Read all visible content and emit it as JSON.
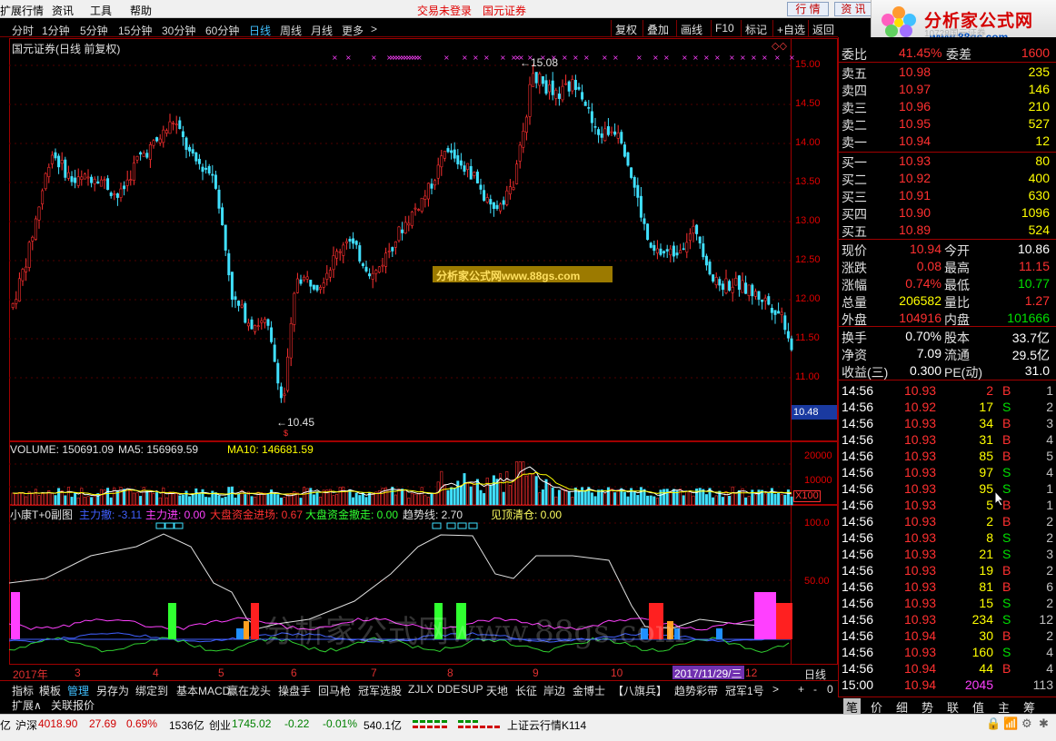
{
  "menu": {
    "items": [
      "扩展行情",
      "资讯",
      "工具",
      "帮助"
    ],
    "trade_status": "交易未登录",
    "broker_name": "国元证券",
    "buttons": [
      "行 情",
      "资 讯"
    ]
  },
  "logo": {
    "title": "分析家公式网",
    "subtitle": "www.88gs.com",
    "faint_caption": "10728国元证券"
  },
  "periods": {
    "items": [
      "分时",
      "1分钟",
      "5分钟",
      "15分钟",
      "30分钟",
      "60分钟",
      "日线",
      "周线",
      "月线",
      "更多"
    ],
    "active": "日线",
    "more_arrow": ">",
    "right_buttons": [
      "复权",
      "叠加",
      "画线",
      "F10",
      "标记",
      "+自选",
      "返回"
    ]
  },
  "chart": {
    "stock_title": "国元证券(日线 前复权)",
    "price_axis": [
      "15.00",
      "14.50",
      "14.00",
      "13.50",
      "13.00",
      "12.50",
      "12.00",
      "11.50",
      "11.00"
    ],
    "current_price_tag": "10.48",
    "high_label": "15.08",
    "low_label": "10.45",
    "high_arrow": "←",
    "low_arrow": "←",
    "watermark": "分析家公式网www.88gs.com",
    "bottom_watermark": "分析家公式网www.88gs.com",
    "volume_legend": {
      "volume_label": "VOLUME: 150691.09",
      "ma5_label": "MA5: 156969.59",
      "ma10_label": "MA10: 146681.59"
    },
    "volume_axis": [
      "20000",
      "10000"
    ],
    "volume_unit": "X100",
    "indicator_legend": {
      "name": "小康T+0副图",
      "main_sell": "主力撤: -3.11",
      "main_buy": "主力进: 0.00",
      "big_in": "大盘资金进场: 0.67",
      "big_out": "大盘资金撤走: 0.00",
      "trend": "趋势线: 2.70",
      "top_clear": "见顶清仓: 0.00"
    },
    "indicator_axis": [
      "100.0",
      "50.00"
    ],
    "time_axis": [
      "2017年",
      "3",
      "4",
      "5",
      "6",
      "7",
      "8",
      "9",
      "10",
      "12"
    ],
    "cursor_date": "2017/11/29/三",
    "period_label": "日线",
    "colors": {
      "up": "#ff3030",
      "down": "#40e0ff",
      "frame": "#a00000",
      "ma5": "#ffffff",
      "ma10": "#ffff00"
    }
  },
  "tabs": {
    "row1": [
      "指标",
      "模板",
      "管理",
      "另存为",
      "绑定到",
      "基本MACD",
      "赢在龙头",
      "操盘手",
      "回马枪",
      "冠军选股",
      "ZJLX",
      "DDE",
      "SUP",
      "天地",
      "长征",
      "岸边",
      "金博士",
      "【八旗兵】",
      "趋势彩带",
      "冠军1号",
      ">"
    ],
    "active": "管理",
    "row1_controls": [
      "+",
      "-",
      "0"
    ],
    "row2": [
      "扩展∧",
      "关联报价"
    ]
  },
  "quote": {
    "weibi": {
      "label": "委比",
      "value": "41.45%",
      "label2": "委差",
      "value2": "1600"
    },
    "asks": [
      {
        "label": "卖五",
        "price": "10.98",
        "vol": "235"
      },
      {
        "label": "卖四",
        "price": "10.97",
        "vol": "146"
      },
      {
        "label": "卖三",
        "price": "10.96",
        "vol": "210"
      },
      {
        "label": "卖二",
        "price": "10.95",
        "vol": "527"
      },
      {
        "label": "卖一",
        "price": "10.94",
        "vol": "12"
      }
    ],
    "bids": [
      {
        "label": "买一",
        "price": "10.93",
        "vol": "80"
      },
      {
        "label": "买二",
        "price": "10.92",
        "vol": "400"
      },
      {
        "label": "买三",
        "price": "10.91",
        "vol": "630"
      },
      {
        "label": "买四",
        "price": "10.90",
        "vol": "1096"
      },
      {
        "label": "买五",
        "price": "10.89",
        "vol": "524"
      }
    ],
    "stats": [
      {
        "l1": "现价",
        "v1": "10.94",
        "c1": "red",
        "l2": "今开",
        "v2": "10.86",
        "c2": "wht"
      },
      {
        "l1": "涨跌",
        "v1": "0.08",
        "c1": "red",
        "l2": "最高",
        "v2": "11.15",
        "c2": "red"
      },
      {
        "l1": "涨幅",
        "v1": "0.74%",
        "c1": "red",
        "l2": "最低",
        "v2": "10.77",
        "c2": "grn"
      },
      {
        "l1": "总量",
        "v1": "206582",
        "c1": "yel",
        "l2": "量比",
        "v2": "1.27",
        "c2": "red"
      },
      {
        "l1": "外盘",
        "v1": "104916",
        "c1": "red",
        "l2": "内盘",
        "v2": "101666",
        "c2": "grn"
      }
    ],
    "fund": [
      {
        "l1": "换手",
        "v1": "0.70%",
        "l2": "股本",
        "v2": "33.7亿"
      },
      {
        "l1": "净资",
        "v1": "7.09",
        "l2": "流通",
        "v2": "29.5亿"
      },
      {
        "l1": "收益(三)",
        "v1": "0.300",
        "l2": "PE(动)",
        "v2": "31.0"
      }
    ],
    "ticks": [
      {
        "t": "14:56",
        "p": "10.93",
        "pc": "red",
        "v": "2",
        "vc": "red",
        "bs": "B",
        "bc": "red",
        "n": "1"
      },
      {
        "t": "14:56",
        "p": "10.92",
        "pc": "red",
        "v": "17",
        "vc": "yel",
        "bs": "S",
        "bc": "grn",
        "n": "2"
      },
      {
        "t": "14:56",
        "p": "10.93",
        "pc": "red",
        "v": "34",
        "vc": "yel",
        "bs": "B",
        "bc": "red",
        "n": "3"
      },
      {
        "t": "14:56",
        "p": "10.93",
        "pc": "red",
        "v": "31",
        "vc": "yel",
        "bs": "B",
        "bc": "red",
        "n": "4"
      },
      {
        "t": "14:56",
        "p": "10.93",
        "pc": "red",
        "v": "85",
        "vc": "yel",
        "bs": "B",
        "bc": "red",
        "n": "5"
      },
      {
        "t": "14:56",
        "p": "10.93",
        "pc": "red",
        "v": "97",
        "vc": "yel",
        "bs": "S",
        "bc": "grn",
        "n": "4"
      },
      {
        "t": "14:56",
        "p": "10.93",
        "pc": "red",
        "v": "95",
        "vc": "yel",
        "bs": "S",
        "bc": "grn",
        "n": "1"
      },
      {
        "t": "14:56",
        "p": "10.93",
        "pc": "red",
        "v": "5",
        "vc": "yel",
        "bs": "B",
        "bc": "red",
        "n": "1"
      },
      {
        "t": "14:56",
        "p": "10.93",
        "pc": "red",
        "v": "2",
        "vc": "yel",
        "bs": "B",
        "bc": "red",
        "n": "2"
      },
      {
        "t": "14:56",
        "p": "10.93",
        "pc": "red",
        "v": "8",
        "vc": "yel",
        "bs": "S",
        "bc": "grn",
        "n": "2"
      },
      {
        "t": "14:56",
        "p": "10.93",
        "pc": "red",
        "v": "21",
        "vc": "yel",
        "bs": "S",
        "bc": "grn",
        "n": "3"
      },
      {
        "t": "14:56",
        "p": "10.93",
        "pc": "red",
        "v": "19",
        "vc": "yel",
        "bs": "B",
        "bc": "red",
        "n": "2"
      },
      {
        "t": "14:56",
        "p": "10.93",
        "pc": "red",
        "v": "81",
        "vc": "yel",
        "bs": "B",
        "bc": "red",
        "n": "6"
      },
      {
        "t": "14:56",
        "p": "10.93",
        "pc": "red",
        "v": "15",
        "vc": "yel",
        "bs": "S",
        "bc": "grn",
        "n": "2"
      },
      {
        "t": "14:56",
        "p": "10.93",
        "pc": "red",
        "v": "234",
        "vc": "yel",
        "bs": "S",
        "bc": "grn",
        "n": "12"
      },
      {
        "t": "14:56",
        "p": "10.94",
        "pc": "red",
        "v": "30",
        "vc": "yel",
        "bs": "B",
        "bc": "red",
        "n": "2"
      },
      {
        "t": "14:56",
        "p": "10.93",
        "pc": "red",
        "v": "160",
        "vc": "yel",
        "bs": "S",
        "bc": "grn",
        "n": "4"
      },
      {
        "t": "14:56",
        "p": "10.94",
        "pc": "red",
        "v": "44",
        "vc": "yel",
        "bs": "B",
        "bc": "red",
        "n": "4"
      },
      {
        "t": "15:00",
        "p": "10.94",
        "pc": "red",
        "v": "2045",
        "vc": "mag",
        "bs": "",
        "bc": "red",
        "n": "113"
      }
    ],
    "bottom_tabs": [
      "笔",
      "价",
      "细",
      "势",
      "联",
      "值",
      "主",
      "筹"
    ],
    "active_tab": "笔"
  },
  "status": {
    "prefix": "亿",
    "sh_name": "沪深",
    "sh_index": "4018.90",
    "sh_change": "27.69",
    "sh_pct": "0.69%",
    "sh_amount": "1536亿",
    "cy_name": "创业",
    "cy_index": "1745.02",
    "cy_change": "-0.22",
    "cy_pct": "-0.01%",
    "cy_amount": "540.1亿",
    "server": "上证云行情K114"
  }
}
